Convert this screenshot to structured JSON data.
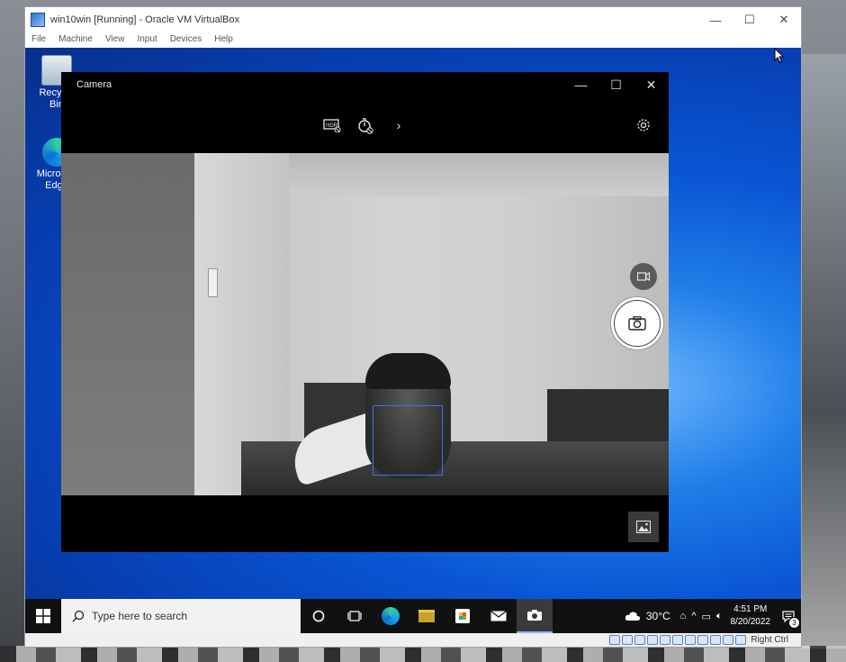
{
  "vbox": {
    "title": "win10win [Running] - Oracle VM VirtualBox",
    "menu": [
      "File",
      "Machine",
      "View",
      "Input",
      "Devices",
      "Help"
    ],
    "host_key": "Right Ctrl",
    "status_icons": [
      "hard-disk-icon",
      "optical-drive-icon",
      "audio-icon",
      "network-icon",
      "usb-icon",
      "shared-folder-icon",
      "display-icon",
      "recording-icon",
      "virtualization-icon",
      "mouse-integration-icon",
      "keyboard-icon"
    ]
  },
  "desktop": {
    "icons": [
      {
        "label": "Recycle Bin",
        "icon": "recycle-bin-icon"
      },
      {
        "label": "Microsoft Edge",
        "icon": "edge-icon"
      }
    ]
  },
  "camera": {
    "title": "Camera",
    "toolbar": [
      "hdr-off-icon",
      "timer-off-icon",
      "chevron-right-icon",
      "settings-icon"
    ],
    "modes": {
      "video": "video-mode-icon",
      "photo": "take-photo-icon"
    }
  },
  "taskbar": {
    "search_placeholder": "Type here to search",
    "apps": [
      "cortana-icon",
      "task-view-icon",
      "edge-icon",
      "file-explorer-icon",
      "store-icon",
      "mail-icon",
      "camera-app-icon"
    ],
    "weather": "30°C",
    "time": "4:51 PM",
    "date": "8/20/2022",
    "notifications": "3"
  },
  "colors": {
    "face_box": "#3b78d6",
    "taskbar": "#111111",
    "desktop_blue": "#0a55d4"
  }
}
